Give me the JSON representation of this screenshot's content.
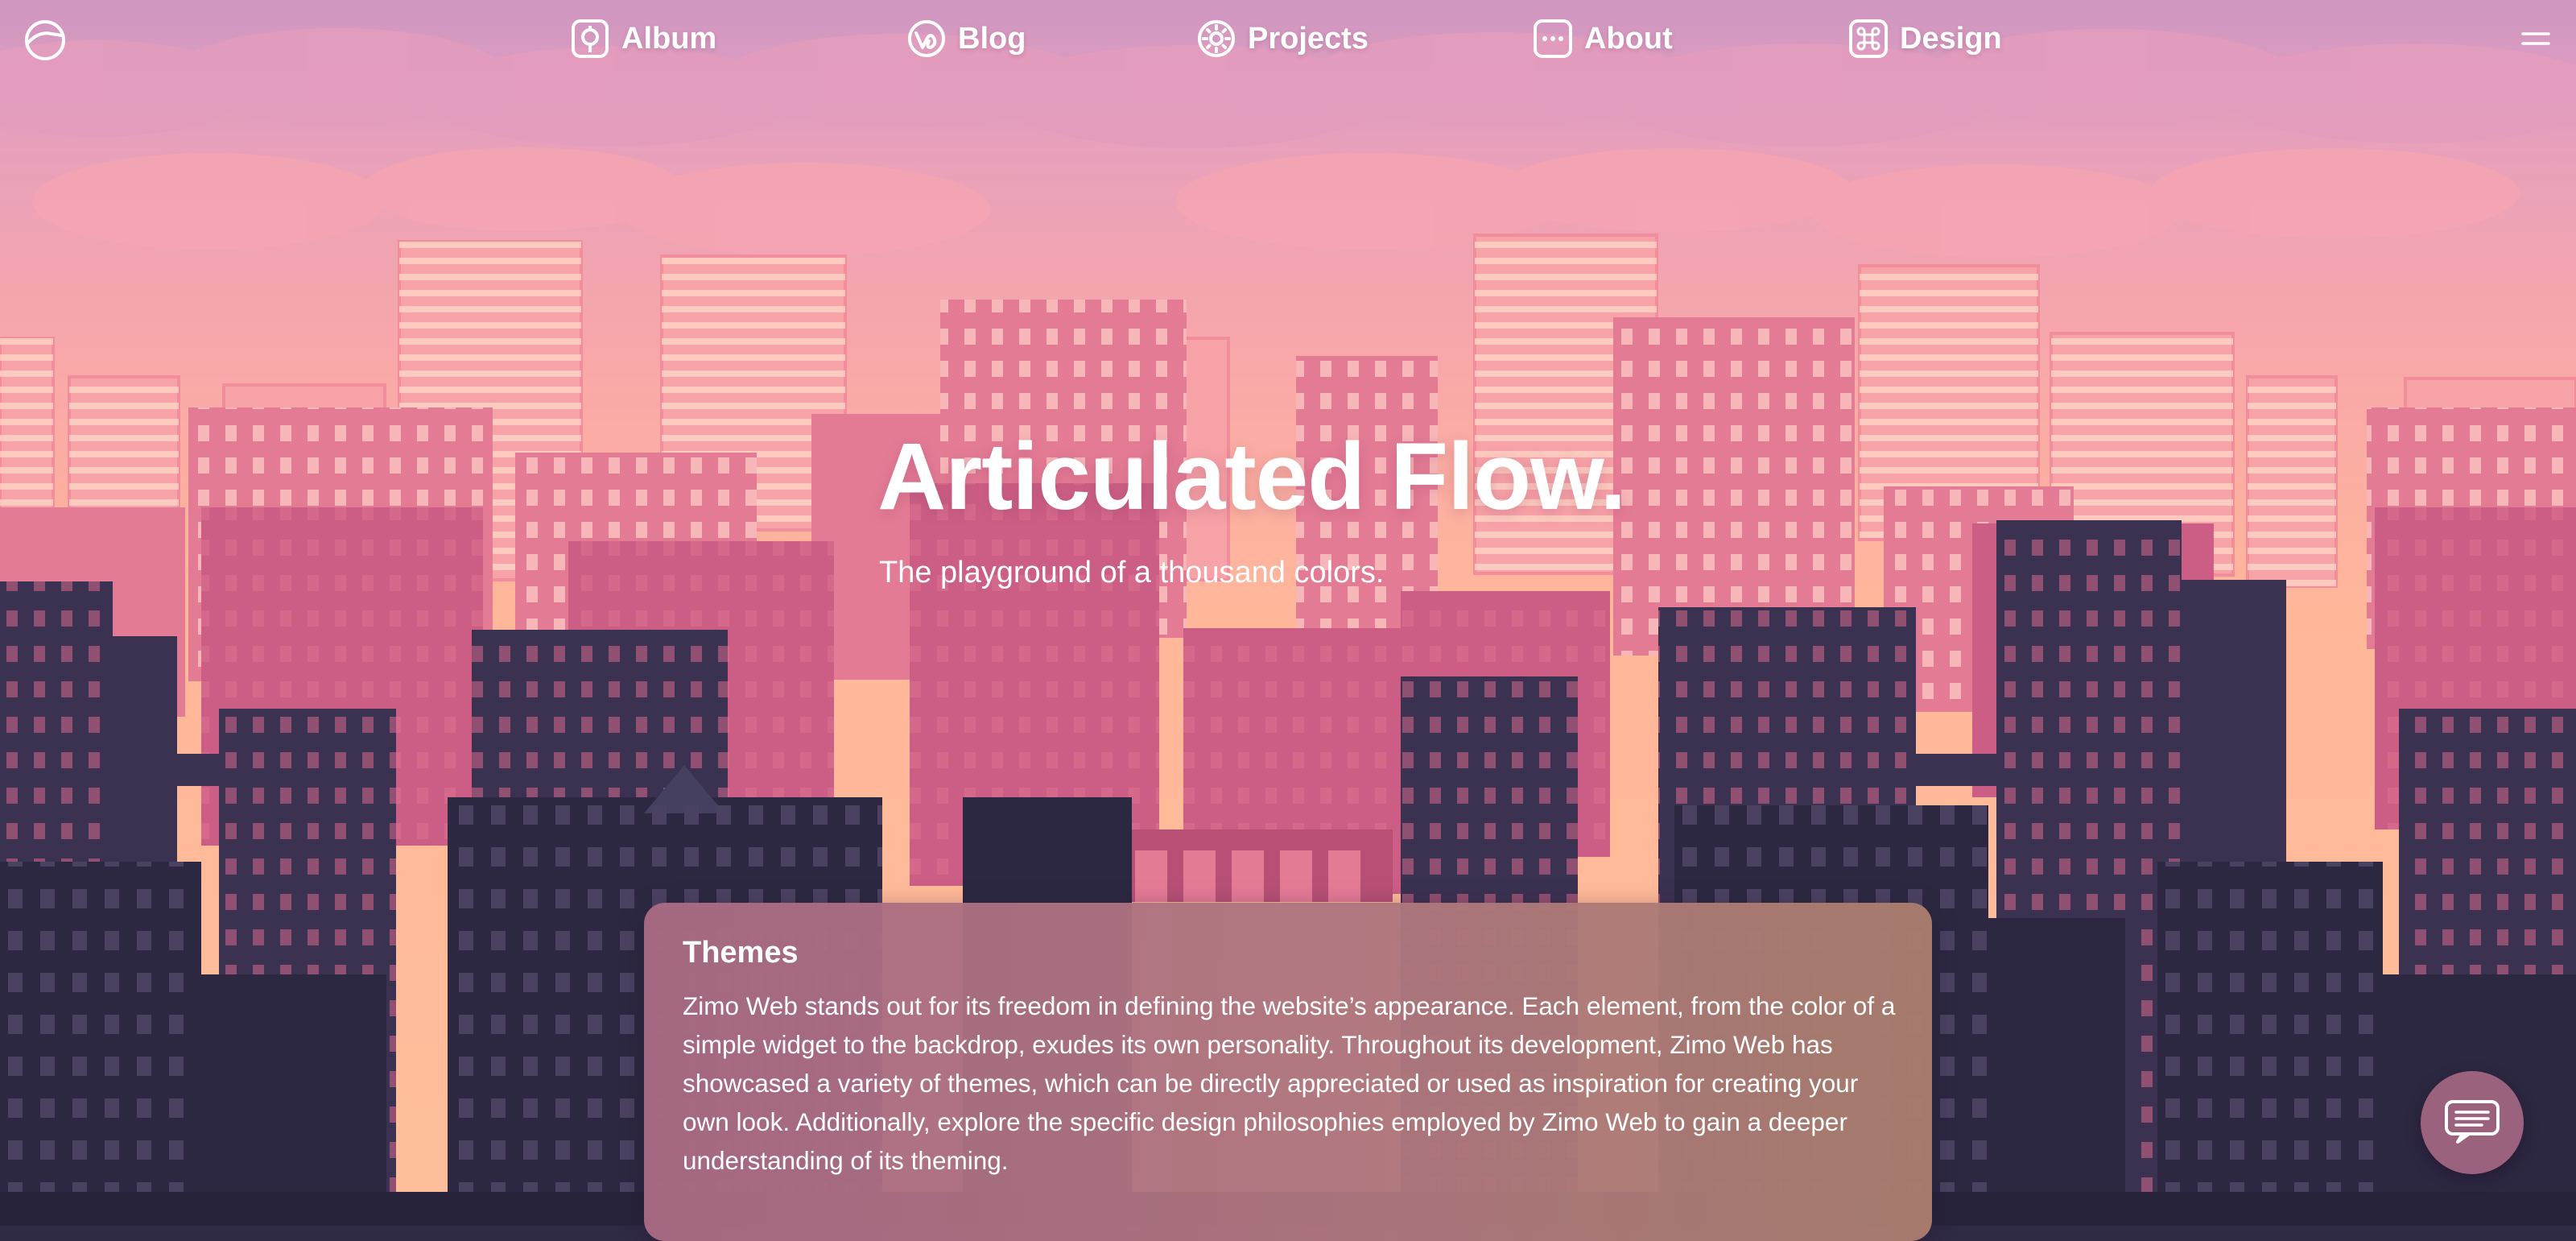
{
  "nav": {
    "logo_icon": "site-logo-icon",
    "items": [
      {
        "label": "Album",
        "icon": "album-icon"
      },
      {
        "label": "Blog",
        "icon": "blog-icon"
      },
      {
        "label": "Projects",
        "icon": "sun-icon"
      },
      {
        "label": "About",
        "icon": "more-dots-icon"
      },
      {
        "label": "Design",
        "icon": "command-icon"
      }
    ],
    "menu_icon": "hamburger-icon"
  },
  "hero": {
    "title": "Articulated Flow.",
    "subtitle": "The playground of a thousand colors."
  },
  "card": {
    "title": "Themes",
    "body": "Zimo Web stands out for its freedom in defining the website’s appearance. Each element, from the color of a simple widget to the backdrop, exudes its own personality. Throughout its development, Zimo Web has showcased a variety of themes, which can be directly appreciated or used as inspiration for creating your own look. Additionally, explore the specific design philosophies employed by Zimo Web to gain a deeper understanding of its theming."
  },
  "fab": {
    "icon": "chat-icon"
  },
  "colors": {
    "sky_top": "#cf97c2",
    "sky_mid": "#f6a5a8",
    "sky_bottom": "#ffb79a",
    "building_far": "#f29ca4",
    "building_mid": "#d9668a",
    "building_near": "#3c3252",
    "building_front": "#2a2640",
    "card_bg": "#ad7480",
    "fab_bg": "#9b627e"
  }
}
